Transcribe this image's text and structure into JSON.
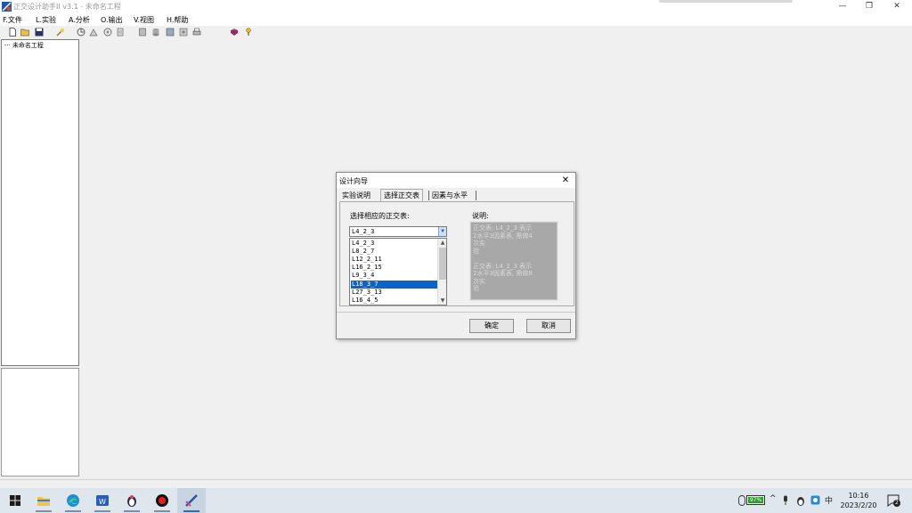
{
  "window": {
    "title": "正交设计助手II v3.1 - 未命名工程"
  },
  "menu": [
    {
      "label": "F.文件"
    },
    {
      "label": "L.实验"
    },
    {
      "label": "A.分析"
    },
    {
      "label": "O.输出"
    },
    {
      "label": "V.视图"
    },
    {
      "label": "H.帮助"
    }
  ],
  "tree": {
    "root": "未命名工程"
  },
  "dialog": {
    "title": "设计向导",
    "tabs": [
      {
        "label": "实验说明"
      },
      {
        "label": "选择正交表"
      },
      {
        "label": "因素与水平"
      }
    ],
    "choose_label": "选择相应的正交表:",
    "combo_value": "L4_2_3",
    "list": [
      {
        "label": "L4_2_3"
      },
      {
        "label": "L8_2_7"
      },
      {
        "label": "L12_2_11"
      },
      {
        "label": "L16_2_15"
      },
      {
        "label": "L9_3_4"
      },
      {
        "label": "L18_3_7"
      },
      {
        "label": "L27_3_13"
      },
      {
        "label": "L16_4_5"
      }
    ],
    "selected_index": 5,
    "desc_label": "说明:",
    "desc_text": "正交表: L4_2_3 表示\n2水平3因素表, 需做4\n次实\n验\n\n正交表: L4_2_3 表示\n2水平3因素表, 需做8\n次实\n验",
    "ok_label": "确定",
    "cancel_label": "取消"
  },
  "taskbar": {
    "battery": "97%",
    "ime": "中",
    "time": "10:16",
    "date": "2023/2/20",
    "notifications": "2"
  },
  "colors": {
    "selection": "#0a64c8",
    "taskbar": "#dfe6ee",
    "desc_bg": "#a8a8a8"
  }
}
